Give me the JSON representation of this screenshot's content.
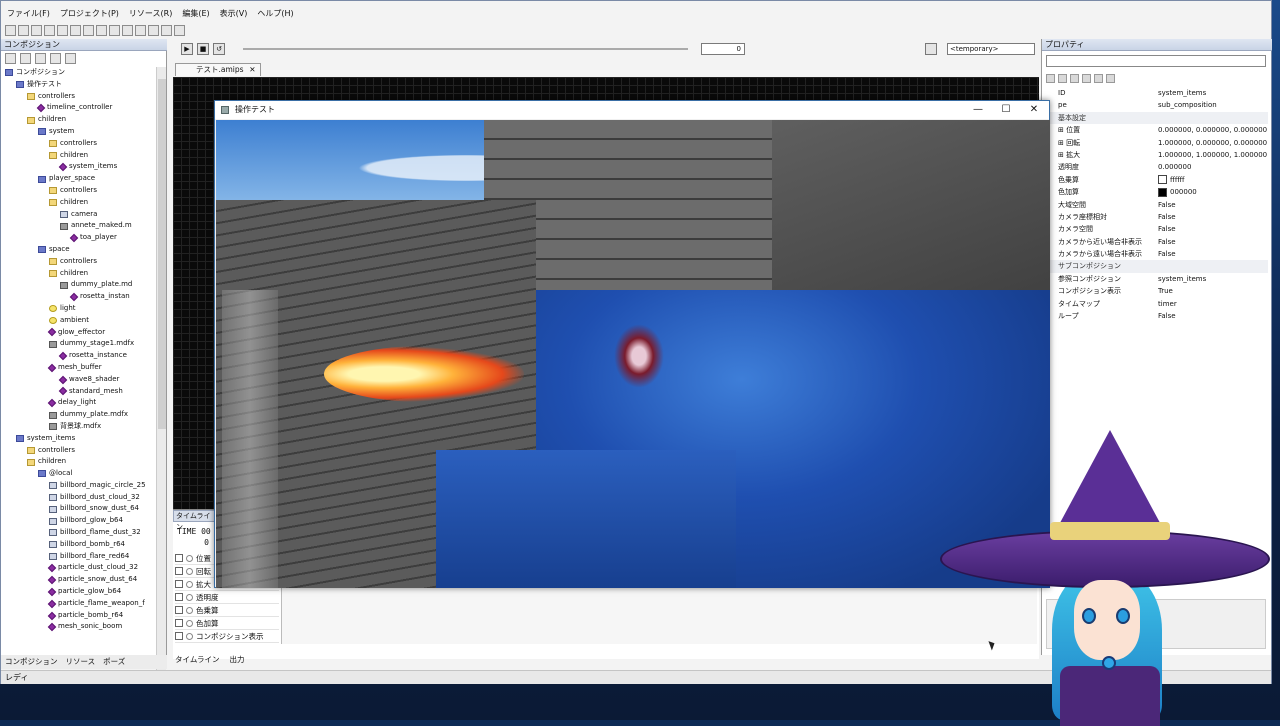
{
  "menubar": [
    "ファイル(F)",
    "プロジェクト(P)",
    "リソース(R)",
    "編集(E)",
    "表示(V)",
    "ヘルプ(H)"
  ],
  "left_panel": {
    "title": "コンポジション",
    "tree": [
      {
        "label": "コンポジション",
        "depth": 0,
        "icon": "comp"
      },
      {
        "label": "操作テスト",
        "depth": 1,
        "icon": "comp"
      },
      {
        "label": "controllers",
        "depth": 2,
        "icon": "folder"
      },
      {
        "label": "timeline_controller",
        "depth": 3,
        "icon": "gem"
      },
      {
        "label": "children",
        "depth": 2,
        "icon": "folder"
      },
      {
        "label": "system",
        "depth": 3,
        "icon": "comp"
      },
      {
        "label": "controllers",
        "depth": 4,
        "icon": "folder"
      },
      {
        "label": "children",
        "depth": 4,
        "icon": "folder"
      },
      {
        "label": "system_items",
        "depth": 5,
        "icon": "gem"
      },
      {
        "label": "player_space",
        "depth": 3,
        "icon": "comp"
      },
      {
        "label": "controllers",
        "depth": 4,
        "icon": "folder"
      },
      {
        "label": "children",
        "depth": 4,
        "icon": "folder"
      },
      {
        "label": "camera",
        "depth": 5,
        "icon": "cam"
      },
      {
        "label": "annete_maked.m",
        "depth": 5,
        "icon": "mesh"
      },
      {
        "label": "toa_player",
        "depth": 6,
        "icon": "gem"
      },
      {
        "label": "space",
        "depth": 3,
        "icon": "comp"
      },
      {
        "label": "controllers",
        "depth": 4,
        "icon": "folder"
      },
      {
        "label": "children",
        "depth": 4,
        "icon": "folder"
      },
      {
        "label": "dummy_plate.md",
        "depth": 5,
        "icon": "mesh"
      },
      {
        "label": "rosetta_instan",
        "depth": 6,
        "icon": "gem"
      },
      {
        "label": "light",
        "depth": 4,
        "icon": "bulb"
      },
      {
        "label": "ambient",
        "depth": 4,
        "icon": "bulb"
      },
      {
        "label": "glow_effector",
        "depth": 4,
        "icon": "gem"
      },
      {
        "label": "dummy_stage1.mdfx",
        "depth": 4,
        "icon": "mesh"
      },
      {
        "label": "rosetta_instance",
        "depth": 5,
        "icon": "gem"
      },
      {
        "label": "mesh_buffer",
        "depth": 4,
        "icon": "gem"
      },
      {
        "label": "wave8_shader",
        "depth": 5,
        "icon": "gem"
      },
      {
        "label": "standard_mesh",
        "depth": 5,
        "icon": "gem"
      },
      {
        "label": "delay_light",
        "depth": 4,
        "icon": "gem"
      },
      {
        "label": "dummy_plate.mdfx",
        "depth": 4,
        "icon": "mesh"
      },
      {
        "label": "背景球.mdfx",
        "depth": 4,
        "icon": "mesh"
      },
      {
        "label": "system_items",
        "depth": 1,
        "icon": "comp"
      },
      {
        "label": "controllers",
        "depth": 2,
        "icon": "folder"
      },
      {
        "label": "children",
        "depth": 2,
        "icon": "folder"
      },
      {
        "label": "@local",
        "depth": 3,
        "icon": "comp"
      },
      {
        "label": "billbord_magic_circle_25",
        "depth": 4,
        "icon": "cam"
      },
      {
        "label": "billbord_dust_cloud_32",
        "depth": 4,
        "icon": "cam"
      },
      {
        "label": "billbord_snow_dust_64",
        "depth": 4,
        "icon": "cam"
      },
      {
        "label": "billbord_glow_b64",
        "depth": 4,
        "icon": "cam"
      },
      {
        "label": "billbord_flame_dust_32",
        "depth": 4,
        "icon": "cam"
      },
      {
        "label": "billbord_bomb_r64",
        "depth": 4,
        "icon": "cam"
      },
      {
        "label": "billbord_flare_red64",
        "depth": 4,
        "icon": "cam"
      },
      {
        "label": "particle_dust_cloud_32",
        "depth": 4,
        "icon": "gem"
      },
      {
        "label": "particle_snow_dust_64",
        "depth": 4,
        "icon": "gem"
      },
      {
        "label": "particle_glow_b64",
        "depth": 4,
        "icon": "gem"
      },
      {
        "label": "particle_flame_weapon_f",
        "depth": 4,
        "icon": "gem"
      },
      {
        "label": "particle_bomb_r64",
        "depth": 4,
        "icon": "gem"
      },
      {
        "label": "mesh_sonic_boom",
        "depth": 4,
        "icon": "gem"
      }
    ],
    "tabs": [
      "コンポジション",
      "リソース",
      "ポーズ"
    ]
  },
  "center": {
    "frame_value": "0",
    "combo_value": "<temporary>",
    "doc_tab": "テスト.amips",
    "timeline": {
      "title": "タイムライン",
      "time_label": "TIME 00",
      "time_value": "0",
      "rows": [
        "位置",
        "回転",
        "拡大",
        "透明度",
        "色乗算",
        "色加算",
        "コンポジション表示"
      ]
    },
    "tabs": [
      "タイムライン",
      "出力"
    ]
  },
  "game_window": {
    "title": "操作テスト",
    "minimize": "—",
    "maximize": "☐",
    "close": "✕"
  },
  "right_panel": {
    "title": "プロパティ",
    "rows": [
      {
        "type": "prop",
        "key": "ID",
        "value": "system_items"
      },
      {
        "type": "prop",
        "key": "pe",
        "value": "sub_composition"
      },
      {
        "type": "cat",
        "key": "基本設定"
      },
      {
        "type": "prop",
        "key": "⊞ 位置",
        "value": "0.000000, 0.000000, 0.000000"
      },
      {
        "type": "prop",
        "key": "⊞ 回転",
        "value": "1.000000, 0.000000, 0.000000"
      },
      {
        "type": "prop",
        "key": "⊞ 拡大",
        "value": "1.000000, 1.000000, 1.000000"
      },
      {
        "type": "prop",
        "key": "透明度",
        "value": "0.000000"
      },
      {
        "type": "prop",
        "key": "色乗算",
        "value": "ffffff",
        "swatch": "#ffffff"
      },
      {
        "type": "prop",
        "key": "色加算",
        "value": "000000",
        "swatch": "#000000"
      },
      {
        "type": "prop",
        "key": "大域空間",
        "value": "False"
      },
      {
        "type": "prop",
        "key": "カメラ座標相対",
        "value": "False"
      },
      {
        "type": "prop",
        "key": "カメラ空間",
        "value": "False"
      },
      {
        "type": "prop",
        "key": "カメラから近い場合非表示",
        "value": "False"
      },
      {
        "type": "prop",
        "key": "カメラから遠い場合非表示",
        "value": "False"
      },
      {
        "type": "cat",
        "key": "サブコンポジション"
      },
      {
        "type": "prop",
        "key": "参照コンポジション",
        "value": "system_items"
      },
      {
        "type": "prop",
        "key": "コンポジション表示",
        "value": "True"
      },
      {
        "type": "prop",
        "key": "タイムマップ",
        "value": "timer"
      },
      {
        "type": "prop",
        "key": "ループ",
        "value": "False"
      }
    ]
  },
  "status": "レディ"
}
